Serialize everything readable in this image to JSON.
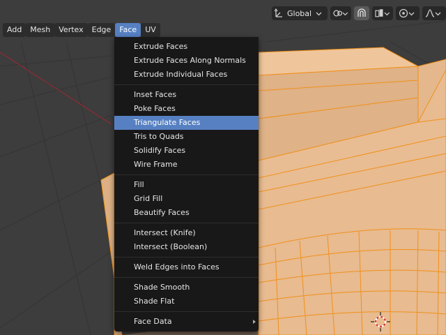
{
  "header": {
    "transform_orientation": "Global"
  },
  "menubar": {
    "items": [
      "Add",
      "Mesh",
      "Vertex",
      "Edge",
      "Face",
      "UV"
    ],
    "selected": "Face"
  },
  "face_menu": {
    "groups": [
      [
        "Extrude Faces",
        "Extrude Faces Along Normals",
        "Extrude Individual Faces"
      ],
      [
        "Inset Faces",
        "Poke Faces",
        "Triangulate Faces",
        "Tris to Quads",
        "Solidify Faces",
        "Wire Frame"
      ],
      [
        "Fill",
        "Grid Fill",
        "Beautify Faces"
      ],
      [
        "Intersect (Knife)",
        "Intersect (Boolean)"
      ],
      [
        "Weld Edges into Faces"
      ],
      [
        "Shade Smooth",
        "Shade Flat"
      ],
      [
        "Face Data"
      ]
    ],
    "highlighted": "Triangulate Faces",
    "submenu_items": [
      "Face Data"
    ]
  },
  "colors": {
    "viewport_bg": "#3d3d3d",
    "mesh_face": "#e8b98e",
    "mesh_edge": "#f0901a",
    "menu_bg": "#181818",
    "highlight": "#5680c2"
  },
  "icons": [
    "transform-orientation-icon",
    "pivot-point-icon",
    "snap-icon",
    "snap-target-icon",
    "proportional-edit-icon",
    "falloff-icon",
    "chevron-down-icon",
    "3d-cursor-icon"
  ]
}
